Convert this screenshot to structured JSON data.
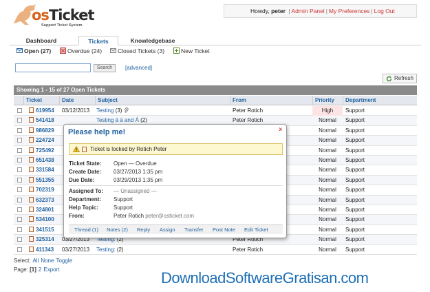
{
  "header": {
    "brand_prefix": "os",
    "brand_name": "Ticket",
    "tagline": "Support Ticket System",
    "greeting": "Howdy,",
    "username": "peter",
    "links": [
      "Admin Panel",
      "My Preferences",
      "Log Out"
    ],
    "separator": "|"
  },
  "tabs": [
    {
      "label": "Dashboard"
    },
    {
      "label": "Tickets",
      "active": true
    },
    {
      "label": "Knowledgebase"
    }
  ],
  "subnav": [
    {
      "label": "Open (27)",
      "icon": "open-tickets-icon",
      "active": true
    },
    {
      "label": "Overdue (24)",
      "icon": "overdue-icon"
    },
    {
      "label": "Closed Tickets (3)",
      "icon": "closed-tickets-icon"
    },
    {
      "label": "New Ticket",
      "icon": "new-ticket-icon"
    }
  ],
  "search": {
    "value": "",
    "button_label": "Search",
    "advanced_label": "[advanced]"
  },
  "refresh_label": "Refresh",
  "table": {
    "showing": "Showing  1 - 15 of 27   Open Tickets",
    "columns": [
      "Ticket",
      "Date",
      "Subject",
      "From",
      "Priority",
      "Department"
    ],
    "rows": [
      {
        "ticket": "619954",
        "date": "03/12/2013",
        "subject": "Testing",
        "count": "(3)",
        "from": "Peter Rotich",
        "priority": "High",
        "dept": "Support"
      },
      {
        "ticket": "541418",
        "date": "",
        "subject": "Testing ä ä and Á",
        "count": "(2)",
        "from": "Peter Rotich",
        "priority": "Normal",
        "dept": "Support"
      },
      {
        "ticket": "986829",
        "date": "",
        "subject": "",
        "count": "",
        "from": "",
        "priority": "Normal",
        "dept": "Support"
      },
      {
        "ticket": "224724",
        "date": "",
        "subject": "",
        "count": "",
        "from": "",
        "priority": "Normal",
        "dept": "Support"
      },
      {
        "ticket": "725492",
        "date": "",
        "subject": "",
        "count": "",
        "from": "",
        "priority": "Normal",
        "dept": "Support"
      },
      {
        "ticket": "651438",
        "date": "",
        "subject": "",
        "count": "",
        "from": "",
        "priority": "Normal",
        "dept": "Support"
      },
      {
        "ticket": "331584",
        "date": "",
        "subject": "",
        "count": "",
        "from": "",
        "priority": "Normal",
        "dept": "Support"
      },
      {
        "ticket": "551355",
        "date": "",
        "subject": "",
        "count": "",
        "from": "",
        "priority": "Normal",
        "dept": "Support"
      },
      {
        "ticket": "702319",
        "date": "",
        "subject": "",
        "count": "",
        "from": "",
        "priority": "Normal",
        "dept": "Support"
      },
      {
        "ticket": "632373",
        "date": "",
        "subject": "",
        "count": "",
        "from": "",
        "priority": "Normal",
        "dept": "Support"
      },
      {
        "ticket": "324801",
        "date": "",
        "subject": "",
        "count": "",
        "from": "",
        "priority": "Normal",
        "dept": "Support"
      },
      {
        "ticket": "534100",
        "date": "",
        "subject": "",
        "count": "",
        "from": "",
        "priority": "Normal",
        "dept": "Support"
      },
      {
        "ticket": "341515",
        "date": "",
        "subject": "",
        "count": "",
        "from": "",
        "priority": "Normal",
        "dept": "Support"
      },
      {
        "ticket": "325314",
        "date": "03/27/2013",
        "subject": "Testing:",
        "count": "(2)",
        "from": "Peter Rotich",
        "priority": "Normal",
        "dept": "Support"
      },
      {
        "ticket": "411343",
        "date": "03/27/2013",
        "subject": "Testing:",
        "count": "(2)",
        "from": "Peter Rotich",
        "priority": "Normal",
        "dept": "Support"
      }
    ]
  },
  "select": {
    "label": "Select:",
    "options": [
      "All",
      "None",
      "Toggle"
    ]
  },
  "pagination": {
    "label": "Page:",
    "current": "[1]",
    "next": "2",
    "export": "Export"
  },
  "popup": {
    "title": "Please help me!",
    "close": "x",
    "lock_message": "Ticket is locked by Rotich Peter",
    "state_label": "Ticket State:",
    "state_value": "Open — Overdue",
    "create_label": "Create Date:",
    "create_value": "03/27/2013  1:35 pm",
    "due_label": "Due Date:",
    "due_value": "03/29/2013  1:35 pm",
    "assigned_label": "Assigned To:",
    "assigned_value": "— Unassigned —",
    "dept_label": "Department:",
    "dept_value": "Support",
    "topic_label": "Help Topic:",
    "topic_value": "Support",
    "from_label": "From:",
    "from_name": "Peter Rotich",
    "from_email": "peter@osticket.com",
    "actions": [
      "Thread (1)",
      "Notes (2)",
      "Reply",
      "Assign",
      "Transfer",
      "Post Note",
      "Edit Ticket"
    ]
  },
  "watermark": "DownloadSoftwareGratisan.com",
  "colors": {
    "link": "#2262a1",
    "header_bar": "#8a8a8a",
    "accent": "#d7641c",
    "warning_bg": "#fdf8d0"
  }
}
